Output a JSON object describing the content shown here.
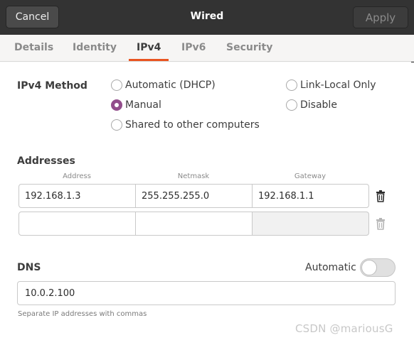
{
  "header": {
    "cancel_label": "Cancel",
    "title": "Wired",
    "apply_label": "Apply"
  },
  "tabs": [
    {
      "label": "Details",
      "active": false
    },
    {
      "label": "Identity",
      "active": false
    },
    {
      "label": "IPv4",
      "active": true
    },
    {
      "label": "IPv6",
      "active": false
    },
    {
      "label": "Security",
      "active": false
    }
  ],
  "ipv4_method": {
    "label": "IPv4 Method",
    "options": [
      {
        "label": "Automatic (DHCP)",
        "checked": false
      },
      {
        "label": "Manual",
        "checked": true
      },
      {
        "label": "Shared to other computers",
        "checked": false
      },
      {
        "label": "Link-Local Only",
        "checked": false
      },
      {
        "label": "Disable",
        "checked": false
      }
    ]
  },
  "addresses": {
    "label": "Addresses",
    "columns": [
      "Address",
      "Netmask",
      "Gateway"
    ],
    "rows": [
      {
        "address": "192.168.1.3",
        "netmask": "255.255.255.0",
        "gateway": "192.168.1.1"
      },
      {
        "address": "",
        "netmask": "",
        "gateway": ""
      }
    ]
  },
  "dns": {
    "label": "DNS",
    "automatic_label": "Automatic",
    "automatic_on": false,
    "value": "10.0.2.100",
    "hint": "Separate IP addresses with commas"
  },
  "watermark": "CSDN @mariousG",
  "colors": {
    "accent": "#e95420",
    "radio_checked": "#924d8b",
    "header_bg": "#333333"
  }
}
